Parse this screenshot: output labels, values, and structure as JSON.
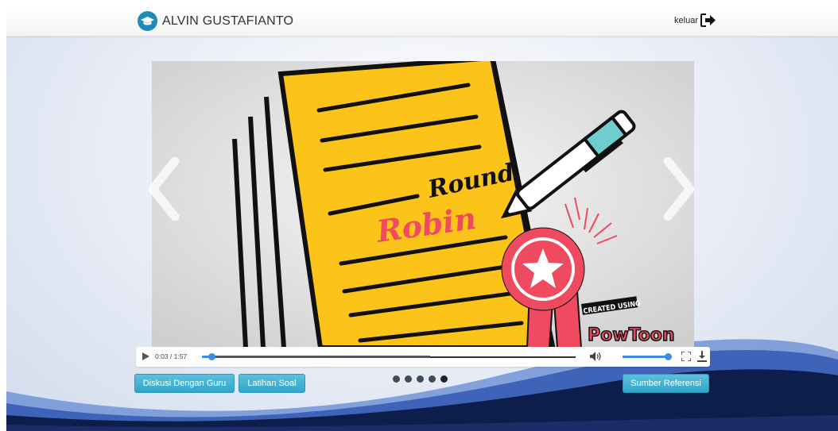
{
  "header": {
    "user_name": "ALVIN GUSTAFIANTO",
    "logout_label": "keluar",
    "logo_icon": "graduation-cap-icon",
    "logout_icon": "sign-out-icon"
  },
  "slide": {
    "word1": "Round",
    "word2": "Robin",
    "badge_top": "CREATED USING",
    "badge_brand": "PowToon"
  },
  "player": {
    "time": "0:03 / 1:57",
    "progress": 0.026,
    "buffered": 0.61,
    "volume": 1.0
  },
  "buttons": {
    "diskusi": "Diskusi Dengan Guru",
    "latihan": "Latihan Soal",
    "sumber": "Sumber Referensi"
  },
  "carousel": {
    "dot_count": 5,
    "active_index": 4
  },
  "colors": {
    "accent": "#5bc0de",
    "player_blue": "#3b8ee8",
    "paper": "#fcc419",
    "pen_teal": "#6fcdd0",
    "badge_red": "#ef4a5f",
    "wave_dark": "#0d1e4a",
    "wave_light": "#5277c4"
  }
}
